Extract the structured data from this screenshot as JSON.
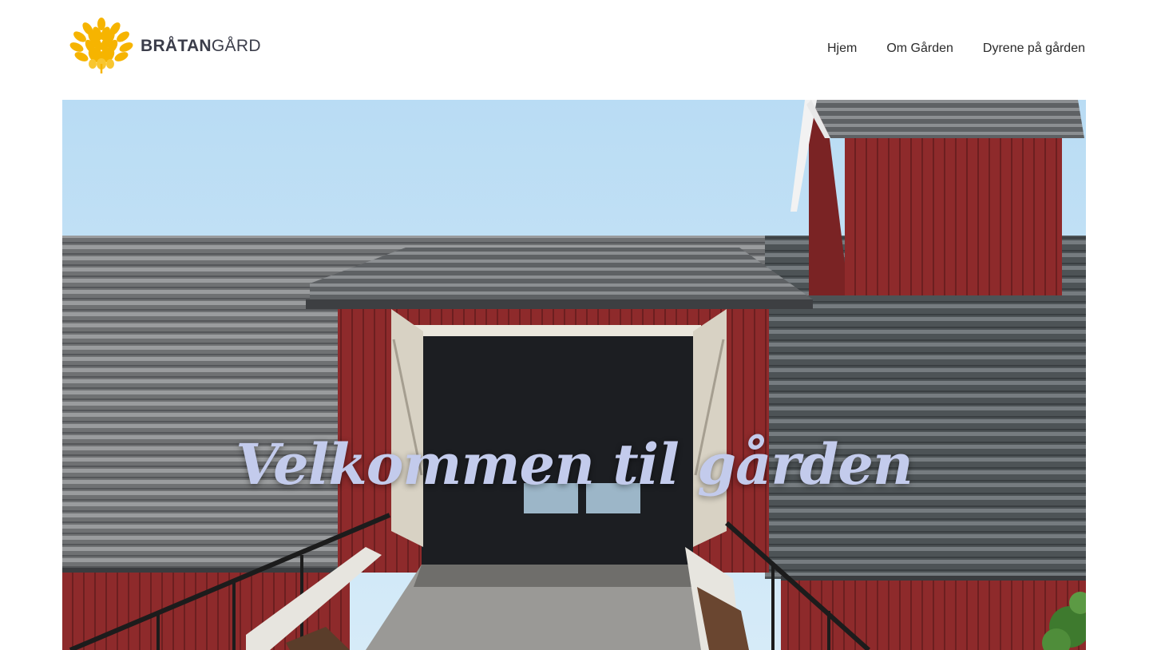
{
  "header": {
    "logo": {
      "icon": "wheat-icon",
      "name_bold": "BRÅTAN",
      "name_regular": "GÅRD"
    },
    "nav": {
      "items": [
        {
          "label": "Hjem"
        },
        {
          "label": "Om Gården"
        },
        {
          "label": "Dyrene på gården"
        }
      ]
    }
  },
  "hero": {
    "title": "Velkommen til gården",
    "image": "red-barn-photo"
  },
  "colors": {
    "logo_yellow": "#f6b400",
    "logo_text": "#3b3d4a",
    "hero_title": "#c3cbec",
    "barn_red": "#8e2a2b"
  }
}
